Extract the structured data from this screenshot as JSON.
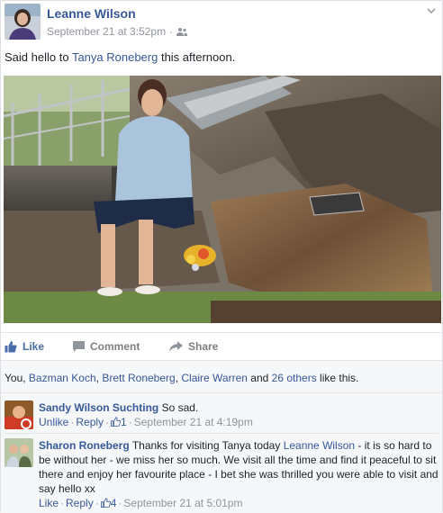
{
  "post": {
    "author": "Leanne Wilson",
    "timestamp": "September 21 at 3:52pm",
    "audience_icon": "friends-icon",
    "text_prefix": "Said hello to ",
    "tagged_person": "Tanya Roneberg",
    "text_suffix": " this afternoon."
  },
  "actions": {
    "like": "Like",
    "comment": "Comment",
    "share": "Share"
  },
  "likes": {
    "prefix": "You, ",
    "people": [
      "Bazman Koch",
      "Brett Roneberg",
      "Claire Warren"
    ],
    "sep": ", ",
    "and": " and ",
    "others": "26 others",
    "suffix": " like this."
  },
  "comments": [
    {
      "author": "Sandy Wilson Suchting",
      "text": "So sad.",
      "action": "Unlike",
      "reply": "Reply",
      "like_count": "1",
      "time": "September 21 at 4:19pm"
    },
    {
      "author": "Sharon Roneberg",
      "text_before": "Thanks for visiting Tanya today ",
      "mention": "Leanne Wilson",
      "text_after": " - it is so hard to be without her - we miss her so much. We visit all the time and find it peaceful to sit there and enjoy her favourite place - I bet she was thrilled you were able to visit and say hello xx",
      "action": "Like",
      "reply": "Reply",
      "like_count": "4",
      "time": "September 21 at 5:01pm"
    }
  ],
  "colors": {
    "link": "#365899",
    "meta": "#90949c",
    "like_blue": "#4b6dab",
    "bg_soft": "#f6f7f9"
  }
}
